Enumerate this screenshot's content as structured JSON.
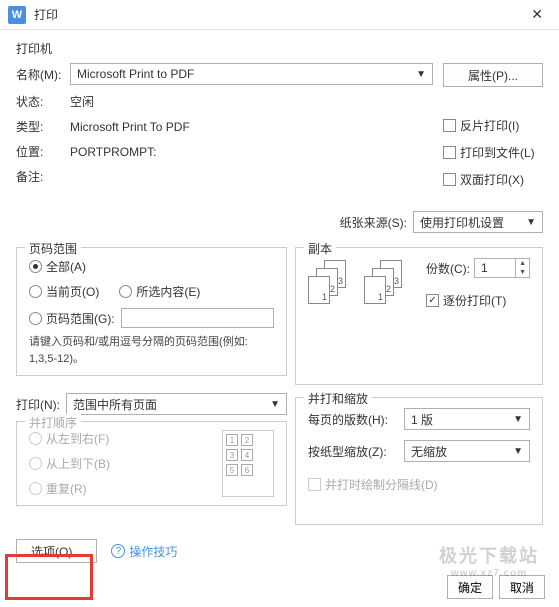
{
  "titlebar": {
    "title": "打印"
  },
  "printer": {
    "section": "打印机",
    "name_label": "名称(M):",
    "name_value": "Microsoft Print to PDF",
    "properties_btn": "属性(P)...",
    "status_label": "状态:",
    "status_value": "空闲",
    "type_label": "类型:",
    "type_value": "Microsoft Print To PDF",
    "location_label": "位置:",
    "location_value": "PORTPROMPT:",
    "comment_label": "备注:",
    "reverse_print": "反片打印(I)",
    "print_to_file": "打印到文件(L)",
    "duplex": "双面打印(X)",
    "paper_source_label": "纸张来源(S):",
    "paper_source_value": "使用打印机设置"
  },
  "page_range": {
    "legend": "页码范围",
    "all": "全部(A)",
    "current": "当前页(O)",
    "selection": "所选内容(E)",
    "pages": "页码范围(G):",
    "hint": "请键入页码和/或用逗号分隔的页码范围(例如: 1,3,5-12)。"
  },
  "copies": {
    "legend": "副本",
    "count_label": "份数(C):",
    "count_value": "1",
    "collate": "逐份打印(T)"
  },
  "print_what": {
    "label": "打印(N):",
    "value": "范围中所有页面"
  },
  "order": {
    "legend": "并打顺序",
    "ltr": "从左到右(F)",
    "ttb": "从上到下(B)",
    "repeat": "重复(R)"
  },
  "scaling": {
    "legend": "并打和缩放",
    "pages_per_sheet_label": "每页的版数(H):",
    "pages_per_sheet_value": "1 版",
    "scale_label": "按纸型缩放(Z):",
    "scale_value": "无缩放",
    "draw_lines": "并打时绘制分隔线(D)"
  },
  "bottom": {
    "options_btn": "选项(O)...",
    "tips": "操作技巧",
    "ok": "确定",
    "cancel": "取消"
  },
  "watermark": {
    "main": "极光下载站",
    "sub": "www.xz7.com"
  }
}
